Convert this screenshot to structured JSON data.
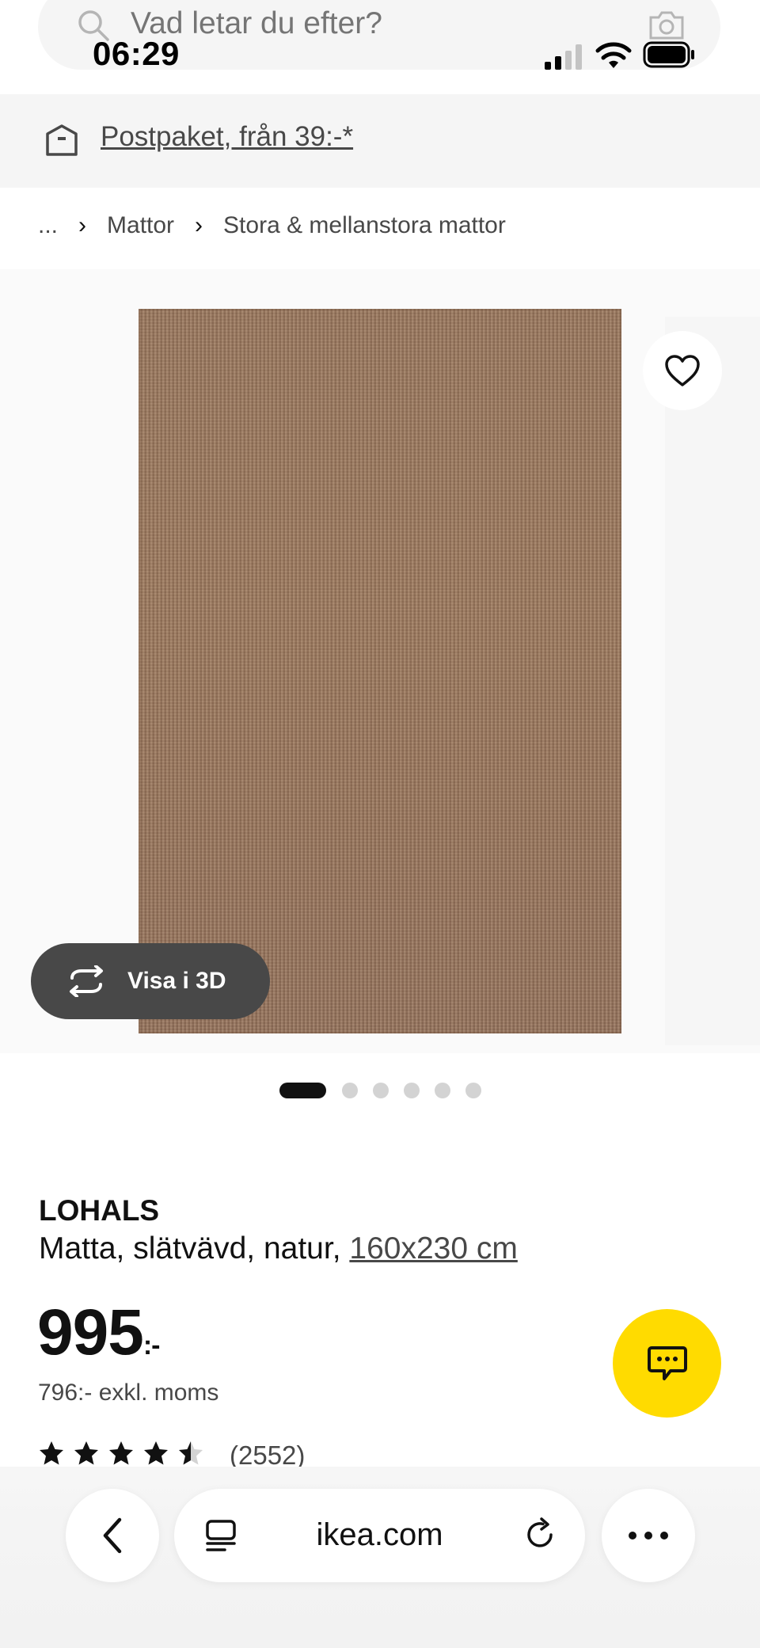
{
  "search": {
    "placeholder": "Vad letar du efter?",
    "icon": "search-icon",
    "camera_icon": "camera-icon"
  },
  "status_bar": {
    "time": "06:29",
    "icons": [
      "signal-icon",
      "wifi-icon",
      "battery-icon"
    ]
  },
  "promo": {
    "icon": "parcel-icon",
    "text": "Postpaket, från 39:-*"
  },
  "breadcrumb": {
    "ellipsis": "...",
    "items": [
      "Mattor",
      "Stora & mellanstora mattor"
    ],
    "separator": "›"
  },
  "gallery": {
    "view_3d_label": "Visa i 3D",
    "slide_count": 6,
    "active_slide": 1
  },
  "product": {
    "name": "LOHALS",
    "description": "Matta, slätvävd, natur, ",
    "size": "160x230 cm",
    "price": "995",
    "price_suffix": ":-",
    "price_ex_vat": "796:- exkl. moms",
    "rating_value": 4.5,
    "rating_max": 5,
    "rating_count": "(2552)"
  },
  "browser": {
    "url": "ikea.com"
  },
  "colors": {
    "chat_button": "#ffdb00",
    "view_3d_button": "#484848",
    "banner_bg": "#f5f5f5"
  }
}
